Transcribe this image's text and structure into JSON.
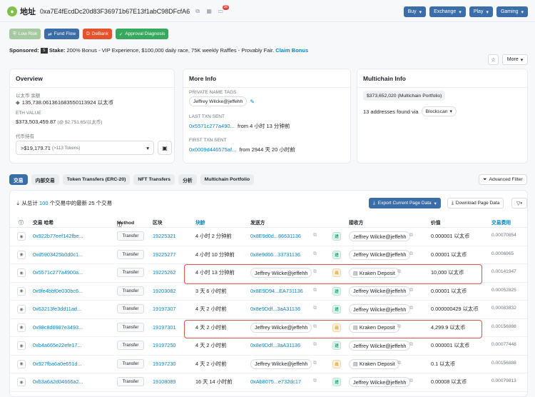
{
  "header": {
    "title": "地址",
    "address": "0xa7E4fEcdDc20d83F36971b67E13f1abC98DFcfA6",
    "notif_count": "36",
    "buttons": [
      "Buy",
      "Exchange",
      "Play",
      "Gaming"
    ]
  },
  "tags": [
    {
      "label": "Low Risk",
      "color": "#a7c9a2"
    },
    {
      "label": "Fund Flow",
      "color": "#3b6ea8"
    },
    {
      "label": "DeBank",
      "color": "#e5532d"
    },
    {
      "label": "Approval Diagnosis",
      "color": "#36a95e"
    }
  ],
  "sponsored": {
    "label": "Sponsored:",
    "brand": "Stake:",
    "text": "200% Bonus - VIP Experience, $100,000 daily race, 75K weekly Raffles - Provably Fair.",
    "link": "Claim Bonus"
  },
  "more_btn": "More",
  "overview": {
    "title": "Overview",
    "bal_label": "以太币 余额",
    "bal_value": "135,738.061361683550113924 以太币",
    "ethv_label": "ETH VALUE",
    "ethv_value": "$373,503,459.87",
    "ethv_sub": "(@ $2,751.65/以太币)",
    "tok_label": "代币持有",
    "tok_value": ">$19,179.71",
    "tok_sub": "(>113 Tokens)"
  },
  "moreinfo": {
    "title": "More Info",
    "pnt_label": "PRIVATE NAME TAGS",
    "pnt_value": "Jeffrey Wilcke@jeffehh",
    "last_label": "LAST TXN SENT",
    "last_hash": "0x5571c277a490...",
    "last_from": "from 4 小时 13 分钟前",
    "first_label": "FIRST TXN SENT",
    "first_hash": "0x0009d446575af...",
    "first_from": "from 2944 天 20 小时前"
  },
  "multichain": {
    "title": "Multichain Info",
    "value": "$373,652,020",
    "value_sub": "(Multichain Portfolio)",
    "found": "13 addresses found via",
    "via": "Blockscan"
  },
  "tabs": [
    "交易",
    "内部交易",
    "Token Transfers (ERC-20)",
    "NFT Transfers",
    "分析",
    "Multichain Portfolio"
  ],
  "adv_filter": "Advanced Filter",
  "table": {
    "latest_prefix": "从总计",
    "latest_count": "100",
    "latest_suffix": "个交易中的最新 25 个交易",
    "export": "Export Current Page Data",
    "download": "Download Page Data",
    "headers": [
      "交易 哈希",
      "Method",
      "区块",
      "块龄",
      "发送方",
      "接收方",
      "价值",
      "交易费用"
    ],
    "rows": [
      {
        "hash": "0x922b77eef142fbe...",
        "method": "Transfer",
        "block": "19225321",
        "age": "4 小时 2 分钟前",
        "from": "0x8E9d0d...86631136",
        "dir": "进",
        "to": "Jeffrey Wilcke@jeffehh",
        "value": "0.000001 以太币",
        "fee": "0.00070854"
      },
      {
        "hash": "0xd5903425b0d0c1...",
        "method": "Transfer",
        "block": "19225277",
        "age": "4 小时 10 分钟前",
        "from": "0x8e9d66...33731136",
        "dir": "进",
        "to": "Jeffrey Wilcke@jeffehh",
        "value": "0.00001 以太币",
        "fee": "0.0006965"
      },
      {
        "hash": "0x5571c277a4900a...",
        "method": "Transfer",
        "block": "19225262",
        "age": "4 小时 13 分钟前",
        "from": "Jeffrey Wilcke@jeffehh",
        "dir": "出",
        "to": "Kraken Deposit",
        "value": "10,000 以太币",
        "fee": "0.00141947"
      },
      {
        "hash": "0x9fe4bbf0e030bc6...",
        "method": "Transfer",
        "block": "19203082",
        "age": "3 天 6 小时前",
        "from": "0x8E9D94...EA731136",
        "dir": "进",
        "to": "Jeffrey Wilcke@jeffehh",
        "value": "0.00001 以太币",
        "fee": "0.00052825"
      },
      {
        "hash": "0x63213fe3dd11ad...",
        "method": "Transfer",
        "block": "19197307",
        "age": "4 天 2 小时前",
        "from": "0x8e9Ddf...3aA31136",
        "dir": "进",
        "to": "Jeffrey Wilcke@jeffehh",
        "value": "0.000000429 以太币",
        "fee": "0.00083832"
      },
      {
        "hash": "0x98c8d6987e3493...",
        "method": "Transfer",
        "block": "19197301",
        "age": "4 天 2 小时前",
        "from": "Jeffrey Wilcke@jeffehh",
        "dir": "出",
        "to": "Kraken Deposit",
        "value": "4,299.9 以太币",
        "fee": "0.00156888"
      },
      {
        "hash": "0xb4a665e22efe17...",
        "method": "Transfer",
        "block": "19197250",
        "age": "4 天 2 小时前",
        "from": "0x8e9Ddf...3aA31136",
        "dir": "进",
        "to": "Jeffrey Wilcke@jeffehh",
        "value": "0.000001 以太币",
        "fee": "0.00077448"
      },
      {
        "hash": "0x927fba6a0e651d...",
        "method": "Transfer",
        "block": "19197230",
        "age": "4 天 2 小时前",
        "from": "Jeffrey Wilcke@jeffehh",
        "dir": "出",
        "to": "Kraken Deposit",
        "value": "0.1 以太币",
        "fee": "0.00156888"
      },
      {
        "hash": "0xb3a6a2d04666a2...",
        "method": "Transfer",
        "block": "19108089",
        "age": "16 天 14 小时前",
        "from": "0xAb8075...e732dc17",
        "dir": "进",
        "to": "Jeffrey Wilcke@jeffehh",
        "value": "0.00008 以太币",
        "fee": "0.00079813"
      }
    ]
  }
}
